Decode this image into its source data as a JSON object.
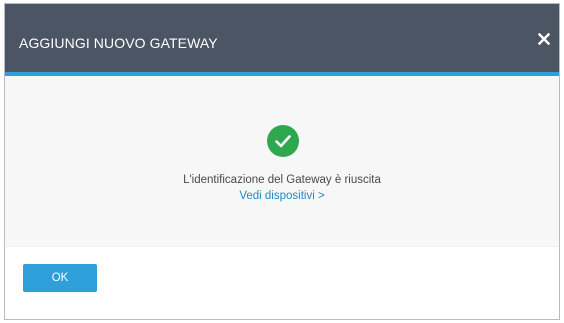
{
  "dialog": {
    "title": "AGGIUNGI NUOVO GATEWAY",
    "close_icon": "close-icon",
    "success_icon": "check-circle-icon",
    "message": "L'identificazione del Gateway è riuscita",
    "link_label": "Vedi dispositivi >",
    "ok_label": "OK"
  },
  "colors": {
    "header": "#4b5563",
    "accent": "#2e9fd8",
    "success": "#2ea84f",
    "link": "#1a8ec7",
    "body_background": "#f7f7f7"
  }
}
